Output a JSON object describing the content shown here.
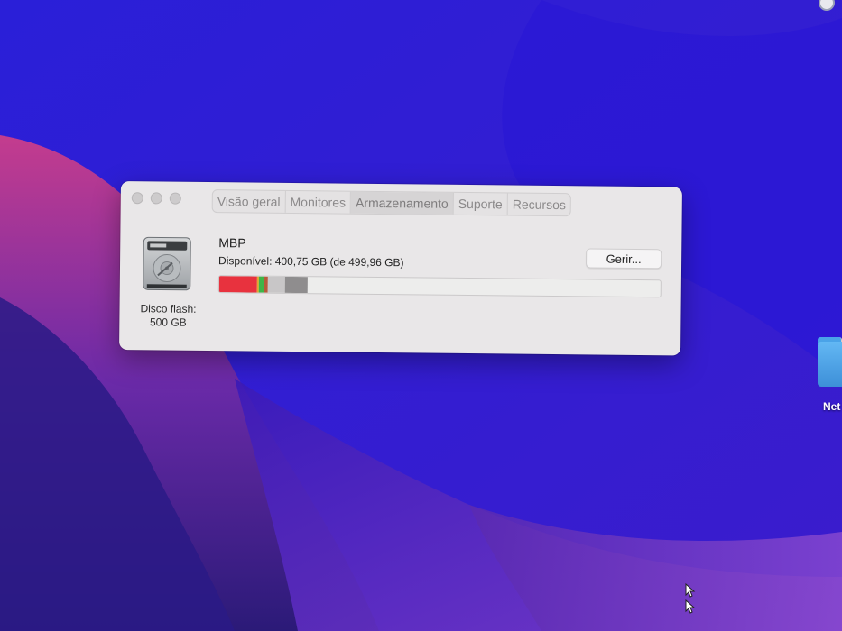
{
  "window": {
    "tabs": [
      {
        "label": "Visão geral",
        "active": false
      },
      {
        "label": "Monitores",
        "active": false
      },
      {
        "label": "Armazenamento",
        "active": true
      },
      {
        "label": "Suporte",
        "active": false
      },
      {
        "label": "Recursos",
        "active": false
      }
    ],
    "disk": {
      "icon": "hard-drive-icon",
      "type_label": "Disco flash:",
      "size_label": "500 GB"
    },
    "volume": {
      "name": "MBP",
      "available_text": "Disponível: 400,75 GB (de 499,96 GB)",
      "manage_label": "Gerir..."
    },
    "storage_bar": {
      "total_gb": 499.96,
      "available_gb": 400.75,
      "segments": [
        {
          "color": "#e8323e",
          "fraction": 0.085
        },
        {
          "color": "#e5a52c",
          "fraction": 0.006
        },
        {
          "color": "#3fb548",
          "fraction": 0.011
        },
        {
          "color": "#b75a3b",
          "fraction": 0.008
        },
        {
          "color": "#c8c6c7",
          "fraction": 0.04
        },
        {
          "color": "#8f8d8e",
          "fraction": 0.05
        }
      ]
    }
  },
  "desktop": {
    "folder": {
      "label": "Net",
      "icon": "folder-icon"
    },
    "cursor_icon": "cursor-icon",
    "top_right_icon": "menu-extra-icon"
  }
}
